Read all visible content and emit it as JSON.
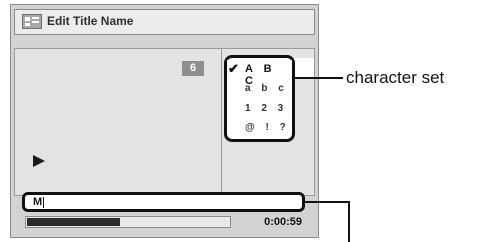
{
  "window": {
    "title": "Edit Title Name",
    "icon": "title-edit-icon"
  },
  "preview": {
    "counter": "6",
    "play_icon": "play-icon"
  },
  "charset": {
    "selected_index": 0,
    "rows": [
      {
        "chars": "A B C",
        "selected": true
      },
      {
        "chars": "a b c",
        "selected": false
      },
      {
        "chars": "1 2 3",
        "selected": false
      },
      {
        "chars": "@ ! ?",
        "selected": false
      }
    ],
    "check_icon": "checkmark-icon"
  },
  "input": {
    "value": "M"
  },
  "progress": {
    "fraction": 0.46,
    "time": "0:00:59"
  },
  "callout": {
    "label": "character set"
  }
}
